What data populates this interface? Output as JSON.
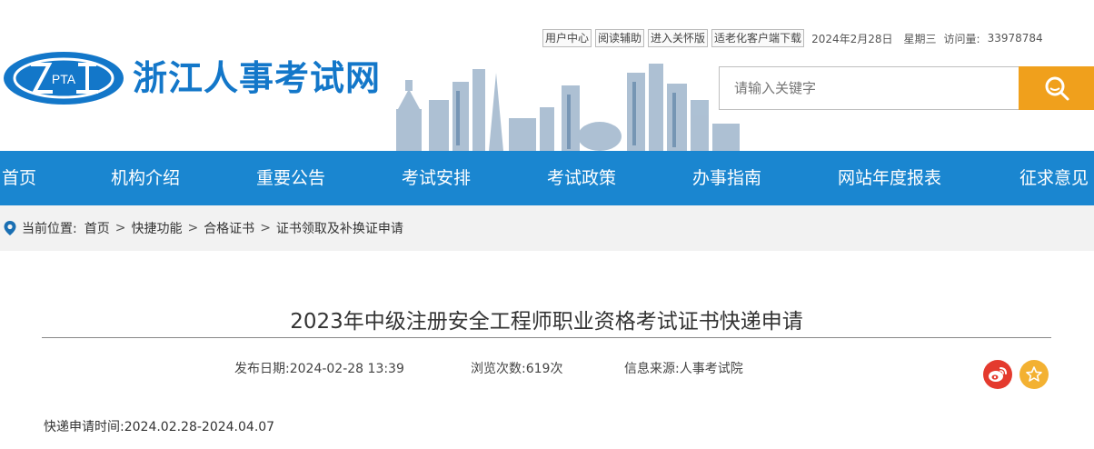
{
  "utility": {
    "links": [
      "用户中心",
      "阅读辅助",
      "进入关怀版",
      "适老化客户端下载"
    ],
    "date": "2024年2月28日",
    "weekday": "星期三",
    "visits_label": "访问量:",
    "visits_value": "33978784"
  },
  "logo": {
    "mark_text": "PTA",
    "title": "浙江人事考试网"
  },
  "search": {
    "placeholder": "请输入关键字",
    "icon": "search-icon"
  },
  "nav": {
    "items": [
      "首页",
      "机构介绍",
      "重要公告",
      "考试安排",
      "考试政策",
      "办事指南",
      "网站年度报表",
      "征求意见"
    ]
  },
  "breadcrumb": {
    "label": "当前位置:",
    "items": [
      "首页",
      "快捷功能",
      "合格证书",
      "证书领取及补换证申请"
    ],
    "separator": ">"
  },
  "article": {
    "title": "2023年中级注册安全工程师职业资格考试证书快递申请",
    "publish_label": "发布日期:",
    "publish_value": "2024-02-28 13:39",
    "views_label": "浏览次数:",
    "views_value": "619次",
    "source_label": "信息来源:",
    "source_value": "人事考试院",
    "body_line_1": "快递申请时间:2024.02.28-2024.04.07"
  },
  "colors": {
    "brand_blue": "#1377c9",
    "nav_blue": "#1a86d0",
    "search_orange": "#f0a01c",
    "weibo_red": "#e43a2e",
    "fav_yellow": "#f3b132"
  }
}
